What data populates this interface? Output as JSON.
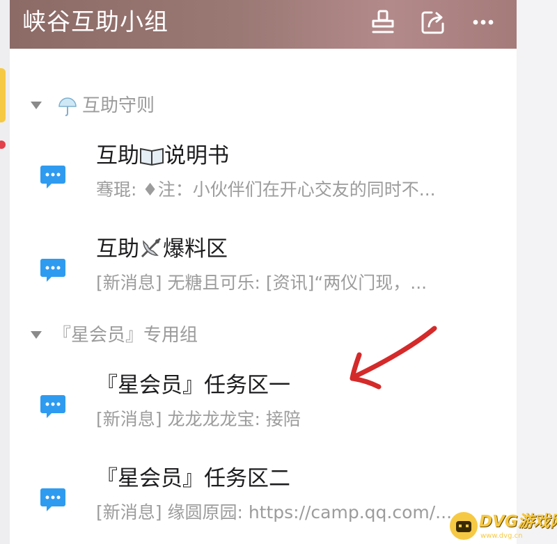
{
  "header": {
    "title": "峡谷互助小组",
    "icons": [
      "stamp-icon",
      "share-icon",
      "more-icon"
    ],
    "gradient": [
      "#8c6a66",
      "#b38a8a"
    ]
  },
  "groups": [
    {
      "label": "互助守则",
      "emoji": "umbrella-icon"
    },
    {
      "label": "『星会员』专用组"
    }
  ],
  "channels": [
    {
      "title_a": "互助",
      "title_b": "说明书",
      "emoji": "book-icon",
      "preview": "骞琨: ♦注：小伙伴们在开心交友的同时不..."
    },
    {
      "title_a": "互助",
      "title_b": "爆料区",
      "emoji": "satellite-icon",
      "preview": "[新消息] 无糖且可乐: [资讯]“两仪门现，..."
    },
    {
      "title": "『星会员』任务区一",
      "preview": "[新消息] 龙龙龙龙宝: 接陪"
    },
    {
      "title": "『星会员』任务区二",
      "preview": "[新消息] 缘圆原园: https://camp.qq.com/..."
    }
  ],
  "watermark": {
    "text": "DVG游戏网",
    "sub": "www.dvg.cn"
  },
  "colors": {
    "chat_icon": "#2f9bf0",
    "arrow": "#d42a2a",
    "text_primary": "#1d1d1f",
    "text_secondary": "#9c9c9c"
  }
}
